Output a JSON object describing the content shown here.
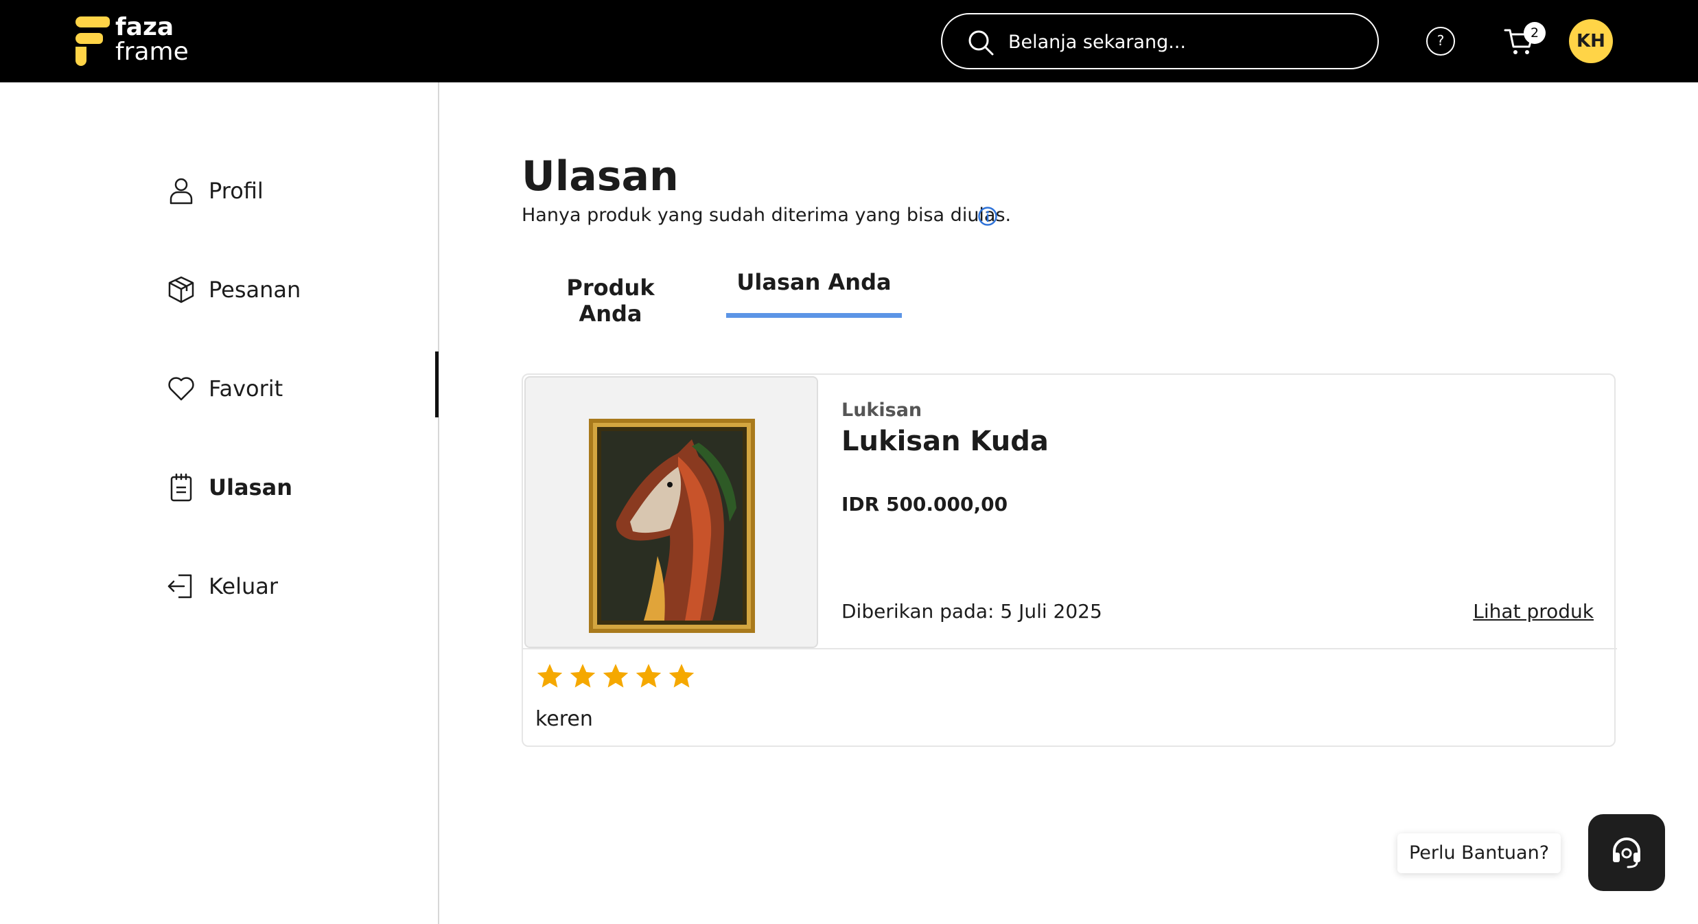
{
  "header": {
    "logo_line1": "faza",
    "logo_line2": "frame",
    "search_placeholder": "Belanja sekarang...",
    "help_glyph": "?",
    "cart_count": "2",
    "avatar_initials": "KH",
    "avatar_color": "#ffd447"
  },
  "sidebar": {
    "items": [
      {
        "label": "Profil",
        "icon": "user-icon"
      },
      {
        "label": "Pesanan",
        "icon": "package-icon"
      },
      {
        "label": "Favorit",
        "icon": "heart-icon"
      },
      {
        "label": "Ulasan",
        "icon": "clipboard-icon",
        "active": true
      },
      {
        "label": "Keluar",
        "icon": "logout-icon"
      }
    ]
  },
  "main": {
    "title": "Ulasan",
    "subtitle": "Hanya produk yang sudah diterima yang bisa diulas.",
    "tabs": [
      {
        "label": "Produk Anda",
        "active": false
      },
      {
        "label": "Ulasan Anda",
        "active": true
      }
    ],
    "tab_accent": "#5c95e6",
    "review": {
      "category": "Lukisan",
      "product_name": "Lukisan Kuda",
      "price": "IDR 500.000,00",
      "given_on": "Diberikan pada: 5 Juli 2025",
      "see_product": "Lihat produk",
      "rating": 5,
      "rating_max": 5,
      "star_color": "#f5a800",
      "comment": "keren"
    }
  },
  "help_widget": {
    "label": "Perlu Bantuan?",
    "icon": "headset-icon"
  }
}
